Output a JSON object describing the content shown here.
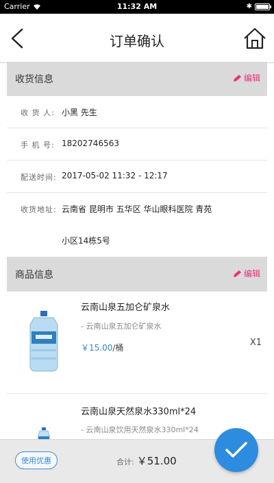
{
  "status_bar": {
    "carrier": "Carrier",
    "time": "11:32 AM",
    "battery_level": 0.9
  },
  "nav": {
    "title": "订单确认",
    "back_icon": "back-chevron-icon",
    "home_icon": "home-icon"
  },
  "receiver_section": {
    "title": "收货信息",
    "edit_label": "编辑"
  },
  "receiver": {
    "name_label": "收 货 人:",
    "name_value": "小黑 先生",
    "phone_label": "手 机 号:",
    "phone_value": "18202746563",
    "time_label": "配送时间:",
    "time_value": "2017-05-02 11:32 - 12:17",
    "address_label": "收货地址:",
    "address_line1": "云南省 昆明市 五华区 华山眼科医院 青苑",
    "address_line2": "小区14栋5号"
  },
  "goods_section": {
    "title": "商品信息",
    "edit_label": "编辑"
  },
  "products": [
    {
      "name": "云南山泉五加仑矿泉水",
      "subtitle": "- 云南山泉五加仑矿泉水",
      "price": "￥15.00",
      "unit": "/桶",
      "qty": "X1"
    },
    {
      "name": "云南山泉天然泉水330ml*24",
      "subtitle": "- 云南山泉饮用天然泉水330ml*24"
    }
  ],
  "bottom": {
    "coupon_label": "使用优惠",
    "total_label": "合计:",
    "total_value": "￥51.00"
  },
  "colors": {
    "accent_blue": "#2d8be0",
    "edit_pink": "#e8327d",
    "price_blue": "#2f86c9"
  }
}
